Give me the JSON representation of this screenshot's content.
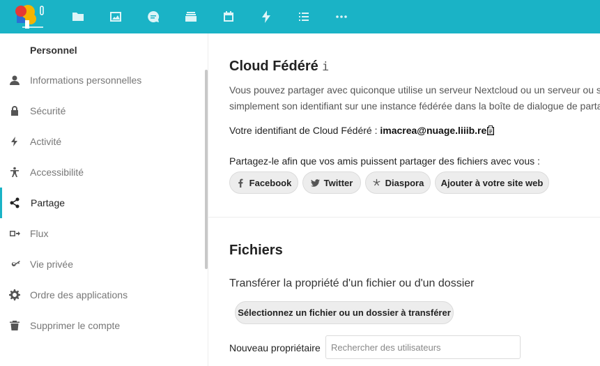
{
  "header": {
    "apps": [
      {
        "name": "files-icon"
      },
      {
        "name": "photos-icon"
      },
      {
        "name": "talk-icon"
      },
      {
        "name": "deck-icon"
      },
      {
        "name": "calendar-icon"
      },
      {
        "name": "activity-icon"
      },
      {
        "name": "tasks-icon"
      },
      {
        "name": "more-apps-icon"
      }
    ]
  },
  "sidebar": {
    "caption": "Personnel",
    "items": [
      {
        "label": "Informations personnelles",
        "icon": "user-icon"
      },
      {
        "label": "Sécurité",
        "icon": "lock-icon"
      },
      {
        "label": "Activité",
        "icon": "lightning-icon"
      },
      {
        "label": "Accessibilité",
        "icon": "accessibility-icon"
      },
      {
        "label": "Partage",
        "icon": "share-icon",
        "active": true
      },
      {
        "label": "Flux",
        "icon": "flow-icon"
      },
      {
        "label": "Vie privée",
        "icon": "key-icon"
      },
      {
        "label": "Ordre des applications",
        "icon": "gear-icon"
      },
      {
        "label": "Supprimer le compte",
        "icon": "trash-icon"
      }
    ]
  },
  "federated": {
    "title": "Cloud Fédéré",
    "info_glyph": "i",
    "desc_line1": "Vous pouvez partager avec quiconque utilise un serveur Nextcloud ou un serveur ou se",
    "desc_line2": "simplement son identifiant sur une instance fédérée dans la boîte de dialogue de parta",
    "id_label": "Votre identifiant de Cloud Fédéré : ",
    "id_value": "imacrea@nuage.liiib.re",
    "share_prompt": "Partagez-le afin que vos amis puissent partager des fichiers avec vous :",
    "buttons": {
      "facebook": "Facebook",
      "twitter": "Twitter",
      "diaspora": "Diaspora",
      "website": "Ajouter à votre site web"
    }
  },
  "files": {
    "title": "Fichiers",
    "transfer_heading": "Transférer la propriété d'un fichier ou d'un dossier",
    "select_button": "Sélectionnez un fichier ou un dossier à transférer",
    "new_owner_label": "Nouveau propriétaire",
    "search_placeholder": "Rechercher des utilisateurs"
  },
  "colors": {
    "accent": "#1ab3c6"
  }
}
